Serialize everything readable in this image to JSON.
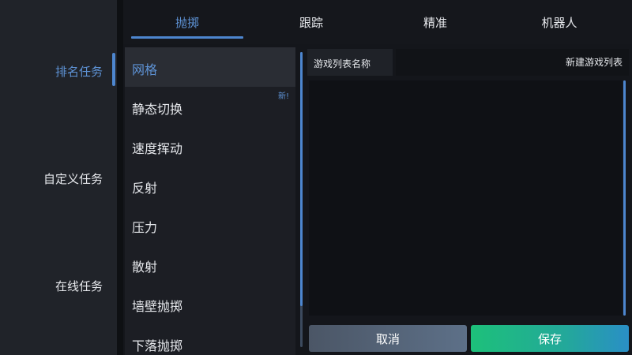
{
  "sidenav": {
    "items": [
      {
        "label": "排名任务",
        "active": true
      },
      {
        "label": "自定义任务",
        "active": false
      },
      {
        "label": "在线任务",
        "active": false
      }
    ]
  },
  "tabs": [
    {
      "label": "抛掷",
      "active": true
    },
    {
      "label": "跟踪",
      "active": false
    },
    {
      "label": "精准",
      "active": false
    },
    {
      "label": "机器人",
      "active": false
    }
  ],
  "modes": [
    {
      "label": "网格",
      "selected": true
    },
    {
      "label": "静态切换",
      "badge": "新!"
    },
    {
      "label": "速度挥动"
    },
    {
      "label": "反射"
    },
    {
      "label": "压力"
    },
    {
      "label": "散射"
    },
    {
      "label": "墙壁抛掷"
    },
    {
      "label": "下落抛掷"
    }
  ],
  "playlist": {
    "name_label": "游戏列表名称",
    "name_placeholder": "新建游戏列表"
  },
  "buttons": {
    "cancel": "取消",
    "save": "保存"
  },
  "colors": {
    "accent": "#4d86cf",
    "active_text": "#5e93d6",
    "save_gradient_start": "#1dc07a",
    "save_gradient_end": "#2a8fc6"
  }
}
